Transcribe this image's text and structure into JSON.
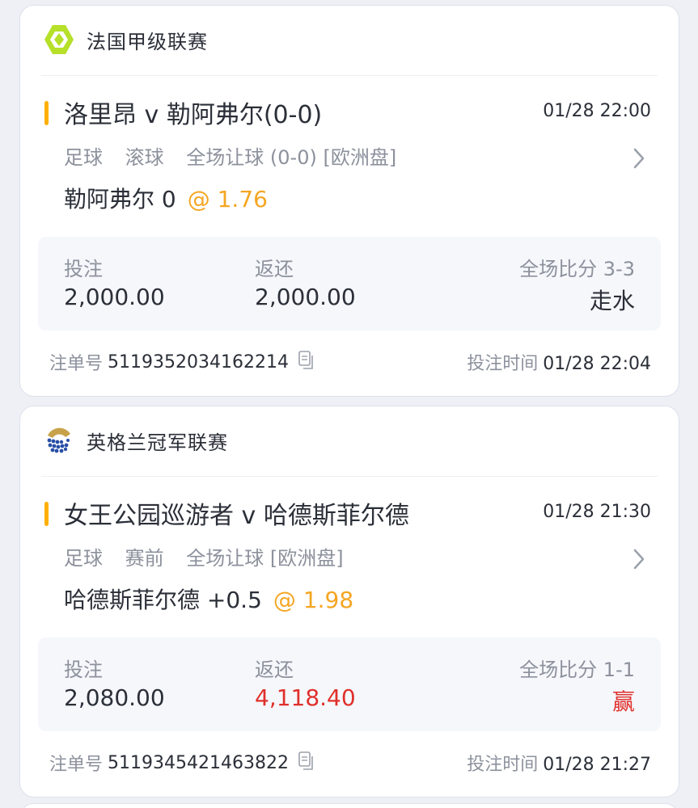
{
  "bets": [
    {
      "league": {
        "name": "法国甲级联赛",
        "icon": "ligue1-logo-icon"
      },
      "match": "洛里昂 v 勒阿弗尔(0-0)",
      "time": "01/28 22:00",
      "market": {
        "sport": "足球",
        "stage": "滚球",
        "type": "全场让球 (0-0) [欧洲盘]"
      },
      "selection": "勒阿弗尔 0",
      "odds": "@ 1.76",
      "stake_label": "投注",
      "stake": "2,000.00",
      "return_label": "返还",
      "return": "2,000.00",
      "score_label": "全场比分 3-3",
      "result": "走水",
      "order_label": "注单号",
      "order_no": "5119352034162214",
      "bet_time_label": "投注时间",
      "bet_time": "01/28 22:04"
    },
    {
      "league": {
        "name": "英格兰冠军联赛",
        "icon": "efl-championship-logo-icon"
      },
      "match": "女王公园巡游者 v 哈德斯菲尔德",
      "time": "01/28 21:30",
      "market": {
        "sport": "足球",
        "stage": "赛前",
        "type": "全场让球 [欧洲盘]"
      },
      "selection": "哈德斯菲尔德 +0.5",
      "odds": "@ 1.98",
      "stake_label": "投注",
      "stake": "2,080.00",
      "return_label": "返还",
      "return": "4,118.40",
      "score_label": "全场比分 1-1",
      "result": "赢",
      "order_label": "注单号",
      "order_no": "5119345421463822",
      "bet_time_label": "投注时间",
      "bet_time": "01/28 21:27"
    }
  ],
  "colors": {
    "accent": "#ffb000",
    "odds": "#f5a623",
    "win": "#e0302b",
    "muted": "#8c919c"
  }
}
